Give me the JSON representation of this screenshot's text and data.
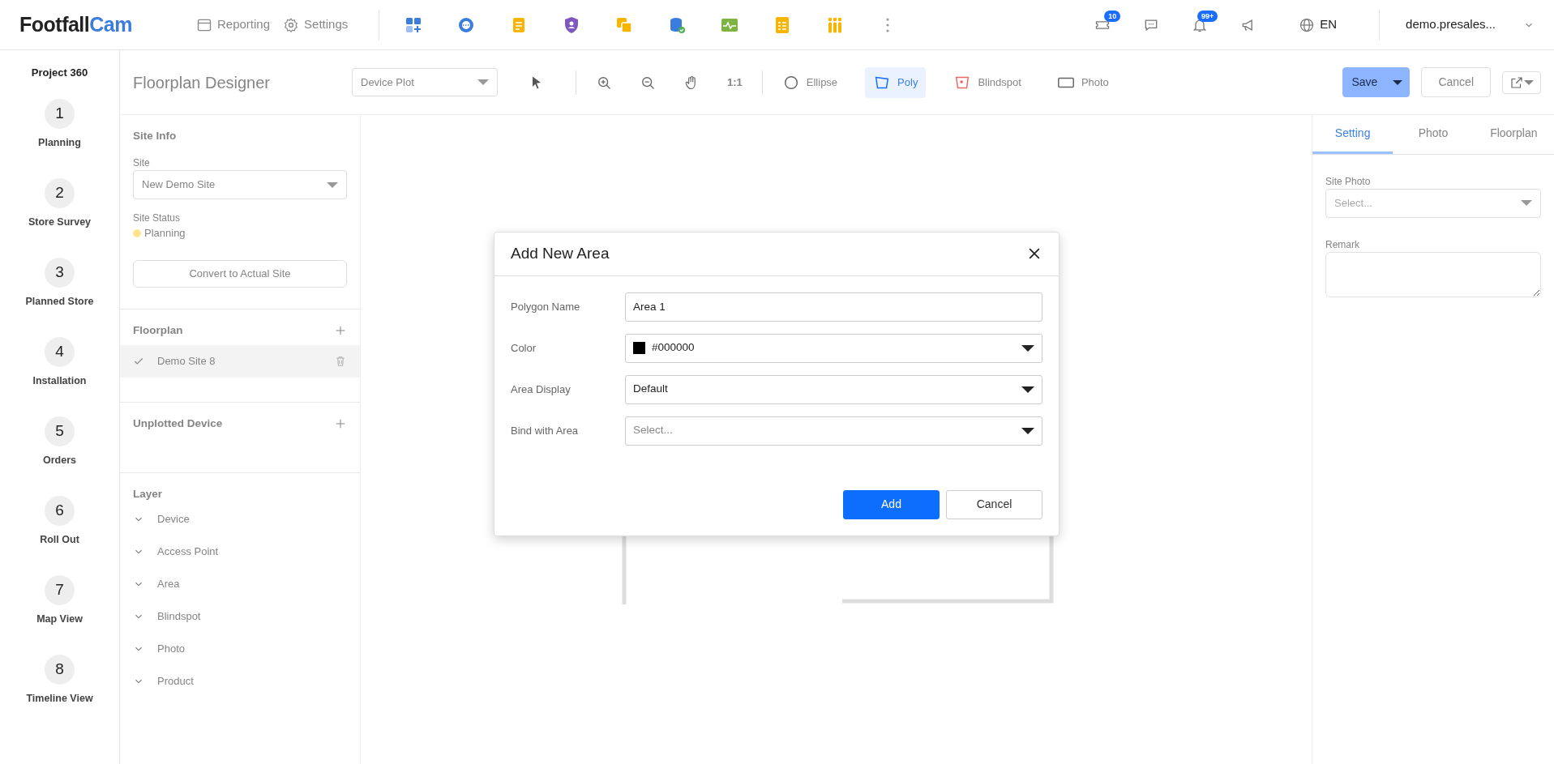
{
  "header": {
    "logo": {
      "part1": "Footfall",
      "part2": "Cam"
    },
    "nav": [
      {
        "label": "Reporting",
        "kind": "calendar"
      },
      {
        "label": "Settings",
        "kind": "gear"
      }
    ],
    "right": {
      "tickets_badge": "10",
      "bell_badge": "99+",
      "language": "EN",
      "user": "demo.presales..."
    }
  },
  "steps_sidebar": {
    "title": "Project 360",
    "steps": [
      {
        "number": "1",
        "label": "Planning"
      },
      {
        "number": "2",
        "label": "Store Survey"
      },
      {
        "number": "3",
        "label": "Planned Store"
      },
      {
        "number": "4",
        "label": "Installation"
      },
      {
        "number": "5",
        "label": "Orders"
      },
      {
        "number": "6",
        "label": "Roll Out"
      },
      {
        "number": "7",
        "label": "Map View"
      },
      {
        "number": "8",
        "label": "Timeline View"
      }
    ]
  },
  "toolbar": {
    "title": "Floorplan Designer",
    "mode_select": "Device Plot",
    "ratio": "1:1",
    "tools": [
      {
        "label": "Ellipse",
        "kind": "ellipse",
        "selected": false
      },
      {
        "label": "Poly",
        "kind": "poly",
        "selected": true
      },
      {
        "label": "Blindspot",
        "kind": "blindspot",
        "selected": false
      },
      {
        "label": "Photo",
        "kind": "photo",
        "selected": false
      }
    ],
    "save": "Save",
    "cancel": "Cancel"
  },
  "left_panel": {
    "site_info": {
      "heading": "Site Info",
      "site_label": "Site",
      "site_value": "New Demo Site",
      "status_label": "Site Status",
      "status": {
        "label": "Planning",
        "color": "#ffe58f"
      },
      "convert_button": "Convert to Actual Site"
    },
    "floorplan": {
      "heading": "Floorplan",
      "items": [
        {
          "label": "Demo Site 8",
          "checked": true
        }
      ]
    },
    "unplotted": {
      "heading": "Unplotted Device"
    },
    "layer": {
      "heading": "Layer",
      "items": [
        {
          "label": "Device",
          "expanded": true
        },
        {
          "label": "Access Point",
          "expanded": true
        },
        {
          "label": "Area",
          "expanded": true
        },
        {
          "label": "Blindspot",
          "expanded": true
        },
        {
          "label": "Photo",
          "expanded": true
        },
        {
          "label": "Product",
          "expanded": true
        }
      ]
    }
  },
  "right_panel": {
    "tabs": [
      {
        "label": "Setting",
        "selected": true
      },
      {
        "label": "Photo",
        "selected": false
      },
      {
        "label": "Floorplan",
        "selected": false
      }
    ],
    "site_photo_label": "Site Photo",
    "site_photo_placeholder": "Select...",
    "remark_label": "Remark"
  },
  "modal": {
    "title": "Add New Area",
    "fields": [
      {
        "label": "Polygon Name",
        "kind": "input",
        "value": "Area 1"
      },
      {
        "label": "Color",
        "kind": "color",
        "value": "#000000",
        "color": "#000000"
      },
      {
        "label": "Area Display",
        "kind": "select",
        "value": "Default"
      },
      {
        "label": "Bind with Area",
        "kind": "select",
        "placeholder": "Select..."
      }
    ],
    "buttons": [
      {
        "label": "Add",
        "kind": "primary"
      },
      {
        "label": "Cancel",
        "kind": "secondary"
      }
    ]
  }
}
